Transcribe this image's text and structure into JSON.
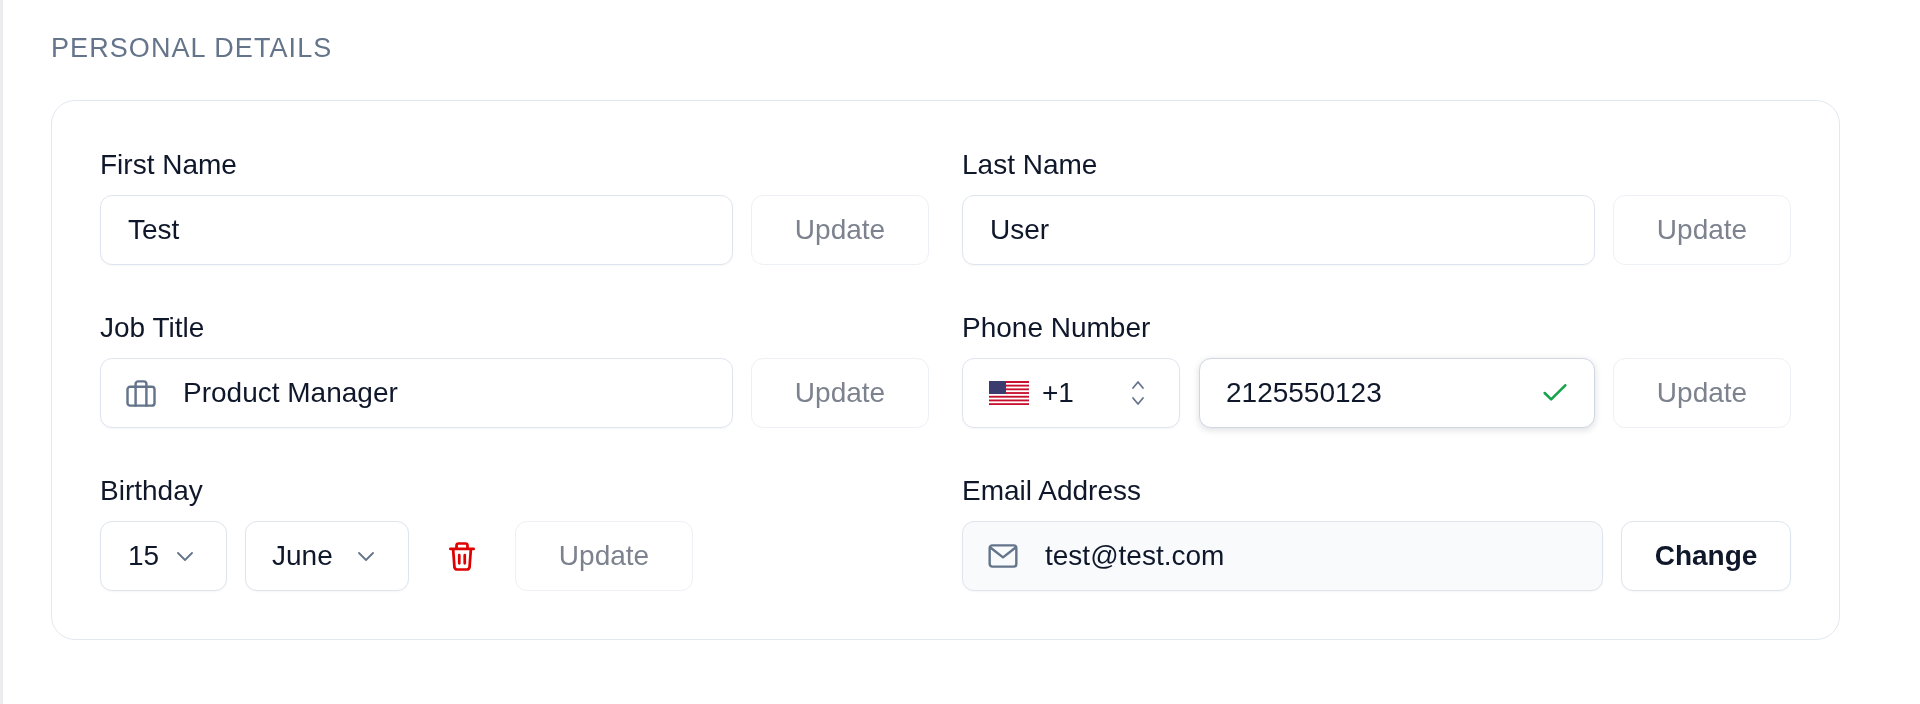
{
  "section": {
    "title": "PERSONAL DETAILS"
  },
  "fields": [
    {
      "kind": "text",
      "label": "First Name",
      "value": "Test",
      "focused": false,
      "button": {
        "label": "Update",
        "disabled": true
      }
    },
    {
      "kind": "text",
      "label": "Last Name",
      "value": "User",
      "focused": false,
      "button": {
        "label": "Update",
        "disabled": true
      }
    },
    {
      "kind": "job",
      "label": "Job Title",
      "value": "Product Manager",
      "focused": false,
      "button": {
        "label": "Update",
        "disabled": true
      }
    },
    {
      "kind": "phone",
      "label": "Phone Number",
      "country_code": "+1",
      "value": "2125550123",
      "valid": true,
      "focused": true,
      "button": {
        "label": "Update",
        "disabled": true
      }
    },
    {
      "kind": "date",
      "label": "Birthday",
      "day": "15",
      "month": "June",
      "focused": false,
      "button": {
        "label": "Update",
        "disabled": true
      }
    },
    {
      "kind": "email",
      "label": "Email Address",
      "value": "test@test.com",
      "focused": false,
      "button": {
        "label": "Change",
        "disabled": false
      }
    }
  ]
}
